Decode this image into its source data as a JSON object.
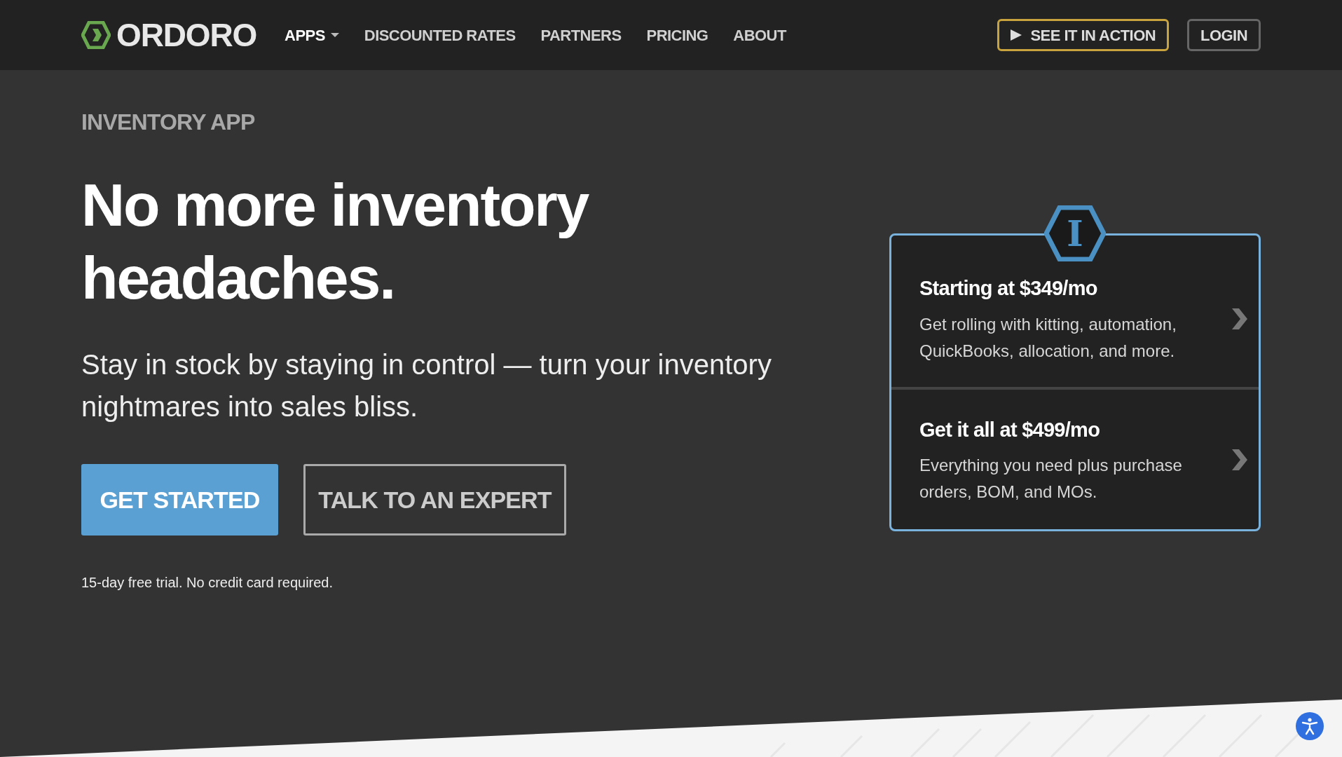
{
  "header": {
    "logo": "ORDORO",
    "nav": [
      {
        "label": "APPS",
        "dropdown": true
      },
      {
        "label": "DISCOUNTED RATES",
        "dropdown": false
      },
      {
        "label": "PARTNERS",
        "dropdown": false
      },
      {
        "label": "PRICING",
        "dropdown": false
      },
      {
        "label": "ABOUT",
        "dropdown": false
      }
    ],
    "actions": [
      {
        "kind": "video",
        "label": "SEE IT IN ACTION"
      },
      {
        "kind": "plain",
        "label": "LOGIN"
      }
    ]
  },
  "hero": {
    "eyebrow": "INVENTORY APP",
    "title": "No more inventory headaches.",
    "subtitle": "Stay in stock by staying in control — turn your inventory nightmares into sales bliss.",
    "buttons": [
      {
        "kind": "primary",
        "label": "GET STARTED"
      },
      {
        "kind": "outline",
        "label": "TALK TO AN EXPERT"
      }
    ],
    "note": "15-day free trial. No credit card required."
  },
  "plans": {
    "badge": "I",
    "items": [
      {
        "title": "Starting at $349/mo",
        "description": "Get rolling with kitting, automation, QuickBooks, allocation, and more."
      },
      {
        "title": "Get it all at $499/mo",
        "description": "Everything you need plus purchase orders, BOM, and MOs."
      }
    ]
  }
}
